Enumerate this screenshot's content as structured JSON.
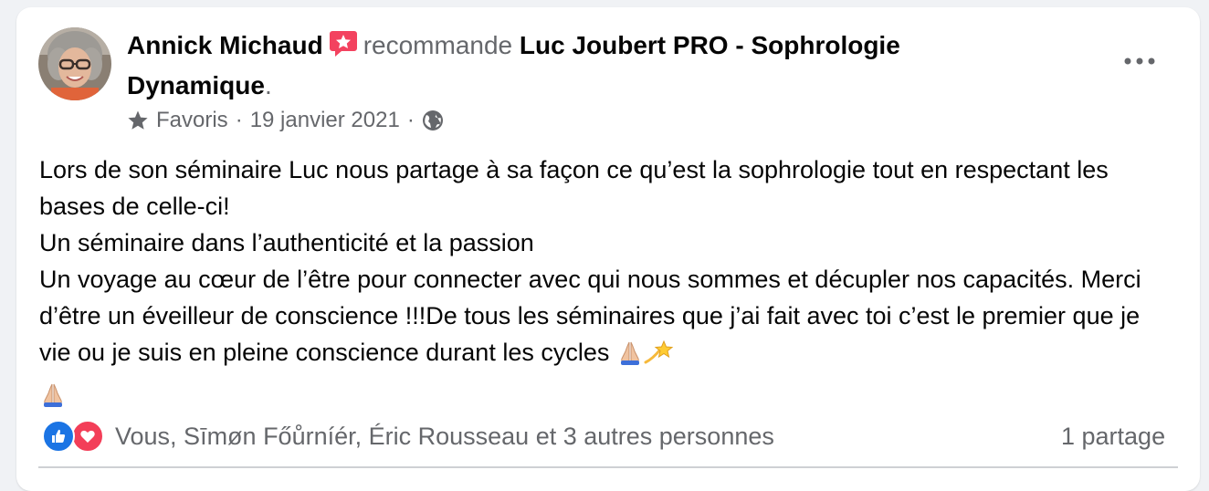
{
  "post": {
    "author": "Annick Michaud",
    "verb": "recommande",
    "page_name_line1": "Luc Joubert PRO - Sophrologie",
    "page_name_line2": "Dynamique",
    "period": ".",
    "category": "Favoris",
    "separator": "·",
    "date": "19 janvier 2021",
    "audience_icon": "globe-icon",
    "recommend_icon": "recommend-star-icon",
    "more_icon": "more-options-icon",
    "body": [
      "Lors de son séminaire Luc nous partage à sa façon ce qu’est la sophrologie tout en respectant les bases de celle-ci!",
      "Un séminaire dans l’authenticité et la passion",
      "Un voyage au cœur de l’être pour connecter avec qui nous sommes et décupler nos capacités. Merci d’être un éveilleur de conscience !!!De tous les séminaires que j’ai fait avec toi c’est le premier que je vie ou je suis en pleine conscience durant les cycles"
    ],
    "emojis": [
      "folded-hands-emoji",
      "dizzy-emoji",
      "folded-hands-emoji"
    ]
  },
  "footer": {
    "reactions": [
      "like-reaction-icon",
      "love-reaction-icon"
    ],
    "reactors": "Vous, Sīmøn Főůrníér, Éric Rousseau et 3 autres personnes",
    "shares": "1 partage"
  },
  "colors": {
    "card": "#ffffff",
    "background": "#f0f2f5",
    "text_primary": "#050505",
    "text_secondary": "#65676b",
    "like_blue": "#1b74e4",
    "love_red": "#f33e58",
    "recommend_pink": "#f3425f"
  }
}
